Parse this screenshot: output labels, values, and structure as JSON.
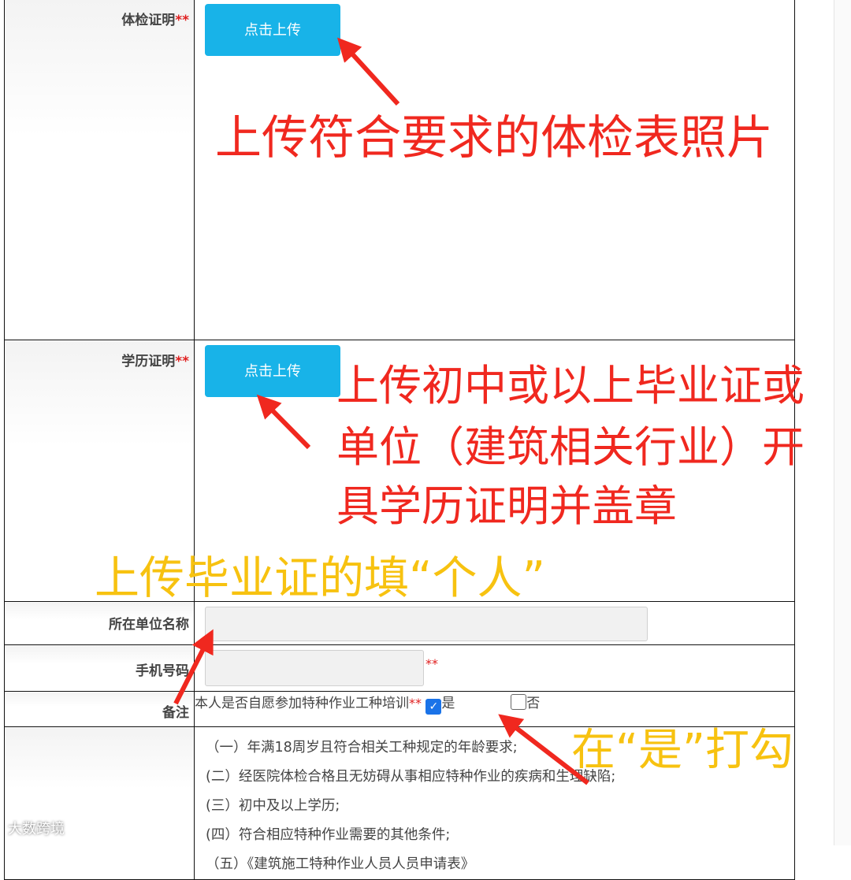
{
  "form": {
    "health_label": "体检证明",
    "education_label": "学历证明",
    "required_mark": "**",
    "upload_button_label": "点击上传",
    "company_label": "所在单位名称",
    "company_value": "",
    "phone_label": "手机号码",
    "phone_value": "",
    "remark_label": "备注",
    "remark_question": "本人是否自愿参加特种作业工种培训",
    "option_yes": "是",
    "option_no": "否",
    "yes_checked": true,
    "conditions": [
      "（一）年满18周岁且符合相关工种规定的年龄要求;",
      "(二）经医院体检合格且无妨碍从事相应特种作业的疾病和生理缺陷;",
      "(三）初中及以上学历;",
      "(四）符合相应特种作业需要的其他条件;",
      "（五）《建筑施工特种作业人员人员申请表》"
    ]
  },
  "annotations": {
    "health_note": "上传符合要求的体检表照片",
    "education_note_line1": "上传初中或以上毕业证或",
    "education_note_line2": "单位（建筑相关行业）开",
    "education_note_line3": "具学历证明并盖章",
    "company_note": "上传毕业证的填“个人”",
    "check_note": "在“是”打勾"
  },
  "watermark": "大数跨境",
  "colors": {
    "upload_button": "#18b3e8",
    "annotation_red": "#f0281f",
    "annotation_yellow": "#f7c210",
    "required_mark": "#e02020"
  }
}
